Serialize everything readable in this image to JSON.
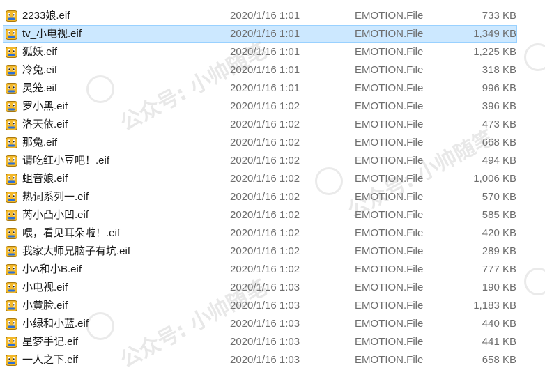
{
  "watermark": "公众号: 小帅随笔",
  "files": [
    {
      "name": "2233娘.eif",
      "date": "2020/1/16 1:01",
      "type": "EMOTION.File",
      "size": "733 KB",
      "selected": false
    },
    {
      "name": "tv_小电视.eif",
      "date": "2020/1/16 1:01",
      "type": "EMOTION.File",
      "size": "1,349 KB",
      "selected": true
    },
    {
      "name": "狐妖.eif",
      "date": "2020/1/16 1:01",
      "type": "EMOTION.File",
      "size": "1,225 KB",
      "selected": false
    },
    {
      "name": "冷兔.eif",
      "date": "2020/1/16 1:01",
      "type": "EMOTION.File",
      "size": "318 KB",
      "selected": false
    },
    {
      "name": "灵笼.eif",
      "date": "2020/1/16 1:01",
      "type": "EMOTION.File",
      "size": "996 KB",
      "selected": false
    },
    {
      "name": "罗小黑.eif",
      "date": "2020/1/16 1:02",
      "type": "EMOTION.File",
      "size": "396 KB",
      "selected": false
    },
    {
      "name": "洛天依.eif",
      "date": "2020/1/16 1:02",
      "type": "EMOTION.File",
      "size": "473 KB",
      "selected": false
    },
    {
      "name": "那兔.eif",
      "date": "2020/1/16 1:02",
      "type": "EMOTION.File",
      "size": "668 KB",
      "selected": false
    },
    {
      "name": "请吃红小豆吧！.eif",
      "date": "2020/1/16 1:02",
      "type": "EMOTION.File",
      "size": "494 KB",
      "selected": false
    },
    {
      "name": "蛆音娘.eif",
      "date": "2020/1/16 1:02",
      "type": "EMOTION.File",
      "size": "1,006 KB",
      "selected": false
    },
    {
      "name": "热词系列一.eif",
      "date": "2020/1/16 1:02",
      "type": "EMOTION.File",
      "size": "570 KB",
      "selected": false
    },
    {
      "name": "芮小凸小凹.eif",
      "date": "2020/1/16 1:02",
      "type": "EMOTION.File",
      "size": "585 KB",
      "selected": false
    },
    {
      "name": "喂，看见耳朵啦！.eif",
      "date": "2020/1/16 1:02",
      "type": "EMOTION.File",
      "size": "420 KB",
      "selected": false
    },
    {
      "name": "我家大师兄脑子有坑.eif",
      "date": "2020/1/16 1:02",
      "type": "EMOTION.File",
      "size": "289 KB",
      "selected": false
    },
    {
      "name": "小A和小B.eif",
      "date": "2020/1/16 1:02",
      "type": "EMOTION.File",
      "size": "777 KB",
      "selected": false
    },
    {
      "name": "小电视.eif",
      "date": "2020/1/16 1:03",
      "type": "EMOTION.File",
      "size": "190 KB",
      "selected": false
    },
    {
      "name": "小黄脸.eif",
      "date": "2020/1/16 1:03",
      "type": "EMOTION.File",
      "size": "1,183 KB",
      "selected": false
    },
    {
      "name": "小绿和小蓝.eif",
      "date": "2020/1/16 1:03",
      "type": "EMOTION.File",
      "size": "440 KB",
      "selected": false
    },
    {
      "name": "星梦手记.eif",
      "date": "2020/1/16 1:03",
      "type": "EMOTION.File",
      "size": "441 KB",
      "selected": false
    },
    {
      "name": "一人之下.eif",
      "date": "2020/1/16 1:03",
      "type": "EMOTION.File",
      "size": "658 KB",
      "selected": false
    }
  ]
}
